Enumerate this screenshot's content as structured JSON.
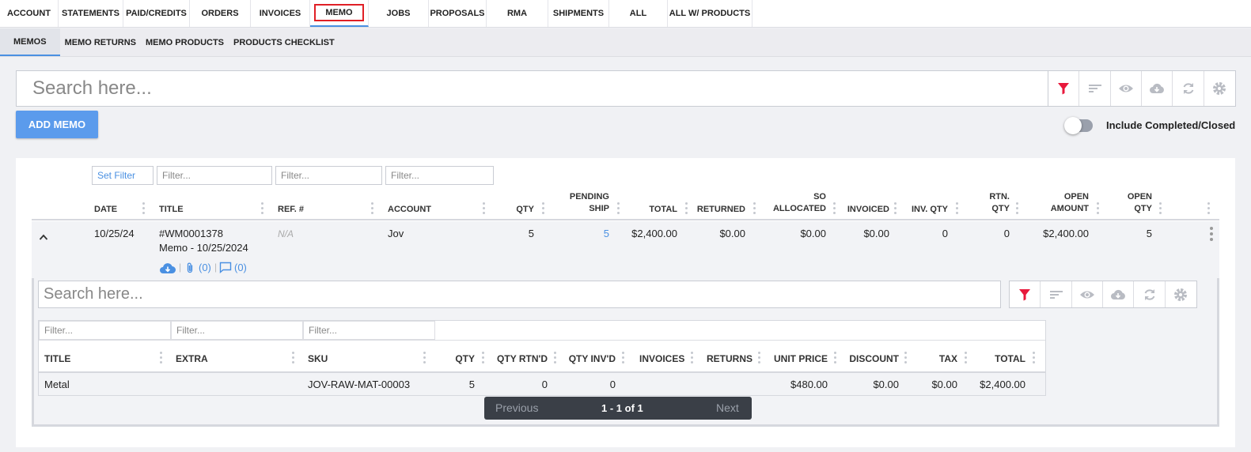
{
  "top_tabs": [
    {
      "label": "ACCOUNT",
      "active": false
    },
    {
      "label": "STATEMENTS",
      "active": false
    },
    {
      "label": "PAID/CREDITS",
      "active": false
    },
    {
      "label": "ORDERS",
      "active": false
    },
    {
      "label": "INVOICES",
      "active": false
    },
    {
      "label": "MEMO",
      "active": true
    },
    {
      "label": "JOBS",
      "active": false
    },
    {
      "label": "PROPOSALS",
      "active": false
    },
    {
      "label": "RMA",
      "active": false
    },
    {
      "label": "SHIPMENTS",
      "active": false
    },
    {
      "label": "ALL",
      "active": false
    },
    {
      "label": "ALL W/ PRODUCTS",
      "active": false
    }
  ],
  "sub_tabs": [
    {
      "label": "MEMOS",
      "active": true
    },
    {
      "label": "MEMO RETURNS",
      "active": false
    },
    {
      "label": "MEMO PRODUCTS",
      "active": false
    },
    {
      "label": "PRODUCTS CHECKLIST",
      "active": false
    }
  ],
  "search": {
    "placeholder": "Search here..."
  },
  "toolbar_icons": [
    "filter-icon",
    "sort-icon",
    "eye-icon",
    "cloud-download-icon",
    "refresh-icon",
    "gear-icon"
  ],
  "colors": {
    "accent": "#4a90e2",
    "filter_active": "#e8193c",
    "highlight_box": "#e01f26",
    "add_button": "#5b9bec"
  },
  "add_button": "ADD MEMO",
  "include_toggle": {
    "label": "Include Completed/Closed",
    "on": false
  },
  "filters": {
    "set_filter": "Set Filter",
    "placeholder": "Filter..."
  },
  "columns": {
    "date": "DATE",
    "title": "TITLE",
    "ref": "REF. #",
    "account": "ACCOUNT",
    "qty": "QTY",
    "pending_1": "PENDING",
    "pending_2": "SHIP",
    "total": "TOTAL",
    "returned": "RETURNED",
    "so_1": "SO",
    "so_2": "ALLOCATED",
    "invoiced": "INVOICED",
    "inv_qty": "INV. QTY",
    "rtn_1": "RTN.",
    "rtn_2": "QTY",
    "open_amount_1": "OPEN",
    "open_amount_2": "AMOUNT",
    "open_qty_1": "OPEN",
    "open_qty_2": "QTY"
  },
  "row": {
    "date": "10/25/24",
    "title_1": "#WM0001378",
    "title_2": "Memo - 10/25/2024",
    "ref": "N/A",
    "account": "Jov",
    "qty": "5",
    "pending_ship": "5",
    "total": "$2,400.00",
    "returned": "$0.00",
    "so_allocated": "$0.00",
    "invoiced": "$0.00",
    "inv_qty": "0",
    "rtn_qty": "0",
    "open_amount": "$2,400.00",
    "open_qty": "5",
    "attachments": "(0)",
    "comments": "(0)"
  },
  "nested": {
    "search_placeholder": "Search here...",
    "columns": {
      "title": "TITLE",
      "extra": "EXTRA",
      "sku": "SKU",
      "qty": "QTY",
      "qty_rtnd": "QTY RTN'D",
      "qty_invd": "QTY INV'D",
      "invoices": "INVOICES",
      "returns": "RETURNS",
      "unit_price": "UNIT PRICE",
      "discount": "DISCOUNT",
      "tax": "TAX",
      "total": "TOTAL"
    },
    "row": {
      "title": "Metal",
      "extra": "",
      "sku": "JOV-RAW-MAT-00003",
      "qty": "5",
      "qty_rtnd": "0",
      "qty_invd": "0",
      "invoices": "",
      "returns": "",
      "unit_price": "$480.00",
      "discount": "$0.00",
      "tax": "$0.00",
      "total": "$2,400.00"
    },
    "pager": {
      "previous": "Previous",
      "range": "1 - 1 of 1",
      "next": "Next"
    }
  }
}
